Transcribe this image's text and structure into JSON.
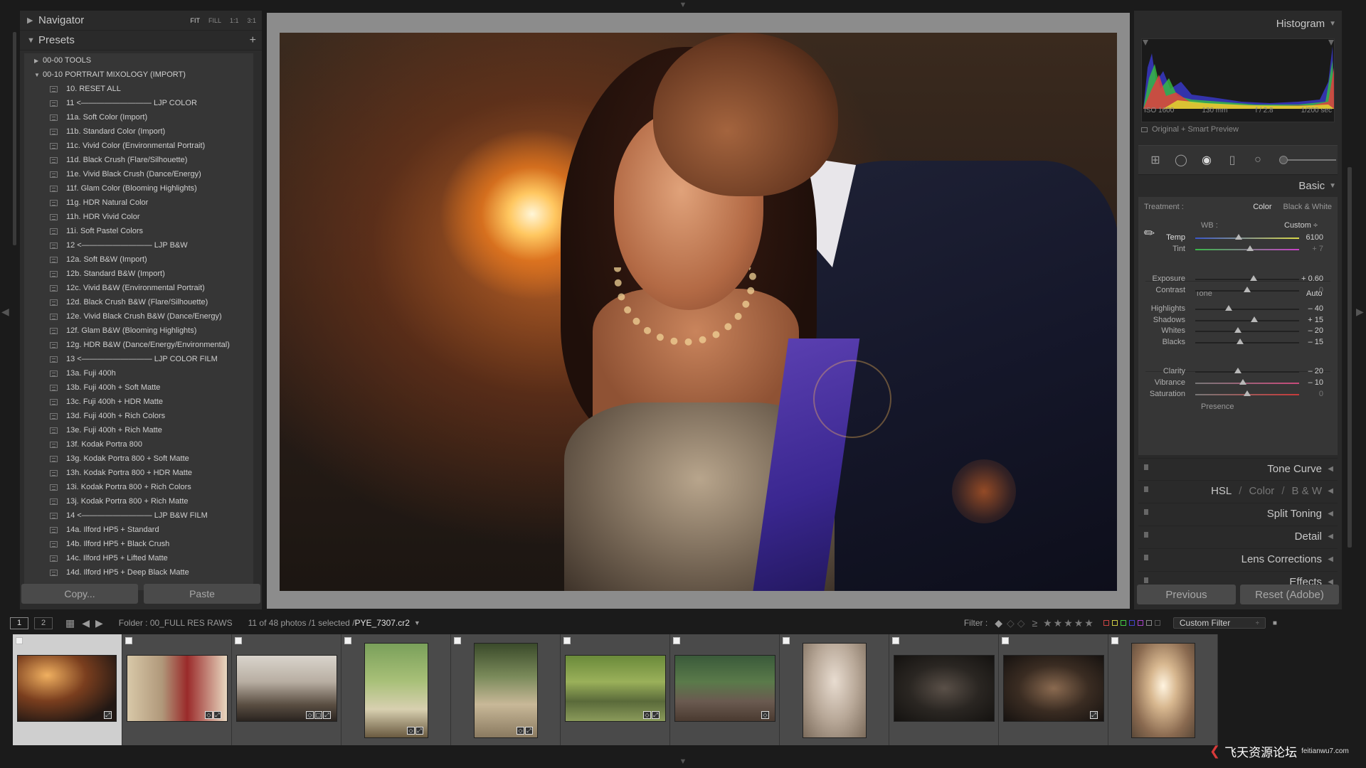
{
  "left_panel": {
    "navigator_title": "Navigator",
    "zoom_options": [
      "FIT",
      "FILL",
      "1:1",
      "3:1"
    ],
    "presets_title": "Presets",
    "add_label": "+",
    "folders": [
      {
        "label": "00-00 TOOLS",
        "expanded": false
      },
      {
        "label": "00-10 PORTRAIT MIXOLOGY (IMPORT)",
        "expanded": true
      }
    ],
    "presets": [
      "10. RESET ALL",
      "11 <————————— LJP COLOR",
      "11a. Soft Color (Import)",
      "11b. Standard Color (Import)",
      "11c. Vivid Color (Environmental Portrait)",
      "11d. Black Crush (Flare/Silhouette)",
      "11e. Vivid Black Crush (Dance/Energy)",
      "11f. Glam Color (Blooming Highlights)",
      "11g. HDR Natural Color",
      "11h. HDR Vivid Color",
      "11i. Soft Pastel Colors",
      "12 <————————— LJP B&W",
      "12a. Soft B&W (Import)",
      "12b. Standard B&W (Import)",
      "12c. Vivid B&W (Environmental Portrait)",
      "12d. Black Crush B&W (Flare/Silhouette)",
      "12e. Vivid Black Crush B&W (Dance/Energy)",
      "12f. Glam B&W (Blooming Highlights)",
      "12g. HDR B&W (Dance/Energy/Environmental)",
      "13 <————————— LJP COLOR FILM",
      "13a. Fuji 400h",
      "13b. Fuji 400h + Soft Matte",
      "13c. Fuji 400h + HDR Matte",
      "13d. Fuji 400h + Rich Colors",
      "13e. Fuji 400h + Rich Matte",
      "13f. Kodak Portra 800",
      "13g. Kodak Portra 800 + Soft Matte",
      "13h. Kodak Portra 800 + HDR Matte",
      "13i. Kodak Portra 800 + Rich Colors",
      "13j. Kodak Portra 800 + Rich Matte",
      "14 <————————— LJP B&W FILM",
      "14a. Ilford HP5 + Standard",
      "14b. Ilford HP5 + Black Crush",
      "14c. Ilford HP5 + Lifted Matte",
      "14d. Ilford HP5 + Deep Black Matte"
    ],
    "copy_label": "Copy...",
    "paste_label": "Paste"
  },
  "right_panel": {
    "histogram_title": "Histogram",
    "hist_info": [
      "ISO 1600",
      "130 mm",
      "f / 2.8",
      "1/200 sec"
    ],
    "smart_preview": "Original + Smart Preview",
    "basic_title": "Basic",
    "treatment_label": "Treatment :",
    "treatment_options": [
      "Color",
      "Black & White"
    ],
    "wb_label": "WB :",
    "wb_value": "Custom ÷",
    "tone_label": "Tone",
    "auto_label": "Auto",
    "presence_label": "Presence",
    "sliders": [
      {
        "key": "temp",
        "label": "Temp",
        "value": "6100",
        "position": 0.42
      },
      {
        "key": "tint",
        "label": "Tint",
        "value": "+ 7",
        "position": 0.53
      },
      {
        "key": "exposure",
        "label": "Exposure",
        "value": "+ 0.60",
        "position": 0.56
      },
      {
        "key": "contrast",
        "label": "Contrast",
        "value": "0",
        "position": 0.5
      },
      {
        "key": "highlights",
        "label": "Highlights",
        "value": "– 40",
        "position": 0.32
      },
      {
        "key": "shadows",
        "label": "Shadows",
        "value": "+ 15",
        "position": 0.57
      },
      {
        "key": "whites",
        "label": "Whites",
        "value": "– 20",
        "position": 0.41
      },
      {
        "key": "blacks",
        "label": "Blacks",
        "value": "– 15",
        "position": 0.43
      },
      {
        "key": "clarity",
        "label": "Clarity",
        "value": "– 20",
        "position": 0.41
      },
      {
        "key": "vibrance",
        "label": "Vibrance",
        "value": "– 10",
        "position": 0.46
      },
      {
        "key": "saturation",
        "label": "Saturation",
        "value": "0",
        "position": 0.5
      }
    ],
    "sections": {
      "tone_curve": "Tone Curve",
      "hsl": "HSL",
      "color": "Color",
      "bw": "B & W",
      "split_toning": "Split Toning",
      "detail": "Detail",
      "lens_corrections": "Lens Corrections",
      "effects": "Effects"
    },
    "previous_label": "Previous",
    "reset_label": "Reset (Adobe)"
  },
  "filmbar": {
    "monitor_1": "1",
    "monitor_2": "2",
    "folder_text": "Folder : 00_FULL RES RAWS",
    "count_text": "11 of 48 photos /1 selected /",
    "filename": "PYE_7307.cr2",
    "filter_label": "Filter :",
    "stars": "≥ ★★★★★",
    "custom_filter": "Custom Filter"
  },
  "filmstrip": {
    "stack_number": "2"
  },
  "watermark": {
    "text": "飞天资源论坛",
    "url": "feitianwu7.com"
  },
  "colors": {
    "panel_bg": "#2c2c2c",
    "presets_bg": "#363636",
    "center_bg": "#8c8c8c",
    "filmstrip_cell": "#4a4a4a",
    "selected_cell": "#cfcfcf"
  }
}
